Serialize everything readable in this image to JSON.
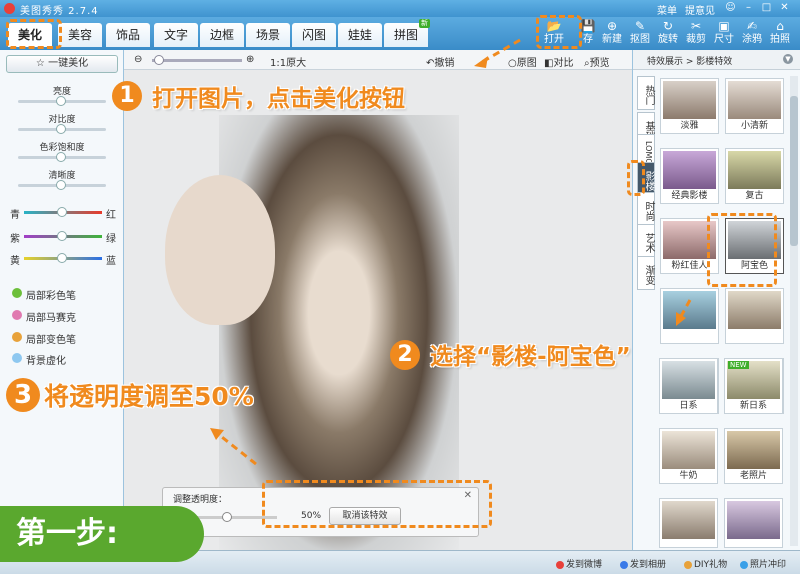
{
  "window": {
    "app_title": "美图秀秀 2.7.4",
    "menu": "菜单",
    "feedback": "提意见",
    "controls": [
      "☺",
      "–",
      "□",
      "✕"
    ]
  },
  "tabs": [
    {
      "label": "美化",
      "active": true
    },
    {
      "label": "美容"
    },
    {
      "label": "饰品"
    },
    {
      "label": "文字"
    },
    {
      "label": "边框"
    },
    {
      "label": "场景"
    },
    {
      "label": "闪图"
    },
    {
      "label": "娃娃"
    },
    {
      "label": "拼图",
      "badge": "新"
    }
  ],
  "tools": [
    {
      "label": "打开",
      "icon": "open-folder-icon",
      "glyph": "📂"
    },
    {
      "label": "存",
      "icon": "save-icon",
      "glyph": "💾"
    },
    {
      "label": "新建",
      "icon": "new-icon",
      "glyph": "⊕"
    },
    {
      "label": "抠图",
      "icon": "cutout-icon",
      "glyph": "✎"
    },
    {
      "label": "旋转",
      "icon": "rotate-icon",
      "glyph": "↻"
    },
    {
      "label": "裁剪",
      "icon": "crop-icon",
      "glyph": "✂"
    },
    {
      "label": "尺寸",
      "icon": "resize-icon",
      "glyph": "▣"
    },
    {
      "label": "涂鸦",
      "icon": "doodle-icon",
      "glyph": "✍"
    },
    {
      "label": "拍照",
      "icon": "camera-icon",
      "glyph": "⌂"
    }
  ],
  "left_panel": {
    "one_key": "一键美化",
    "sliders": [
      "亮度",
      "对比度",
      "色彩饱和度",
      "清晰度"
    ],
    "color_sliders": [
      {
        "left": "青",
        "right": "红"
      },
      {
        "left": "紫",
        "right": "绿"
      },
      {
        "left": "黄",
        "right": "蓝"
      }
    ],
    "local_tools": [
      "局部彩色笔",
      "局部马赛克",
      "局部变色笔",
      "背景虚化"
    ]
  },
  "canvas": {
    "zoom_label": "1:1原大",
    "undo": "撤销",
    "original": "原图",
    "compare": "对比",
    "preview": "预览"
  },
  "opacity_panel": {
    "title": "调整透明度：",
    "value": "50%",
    "cancel": "取消该特效",
    "close": "✕"
  },
  "right_panel": {
    "breadcrumb": "特效展示 > 影楼特效",
    "vertical_tabs": [
      "热门",
      "基础",
      "LOMO",
      "影楼",
      "时尚",
      "艺术",
      "渐变"
    ],
    "effects": [
      {
        "label": "淡雅"
      },
      {
        "label": "小清新"
      },
      {
        "label": "经典影楼"
      },
      {
        "label": "复古"
      },
      {
        "label": "粉红佳人"
      },
      {
        "label": "阿宝色",
        "selected": true
      },
      {
        "label": ""
      },
      {
        "label": ""
      },
      {
        "label": ""
      },
      {
        "label": ""
      },
      {
        "label": "日系"
      },
      {
        "label": "新日系",
        "badge": "NEW"
      },
      {
        "label": "牛奶"
      },
      {
        "label": "老照片"
      },
      {
        "label": ""
      },
      {
        "label": ""
      }
    ]
  },
  "statusbar": {
    "weibo": "发到微博",
    "album": "发到相册",
    "diy": "DIY礼物",
    "print": "照片冲印"
  },
  "annotations": {
    "step1_num": "1",
    "step1_text": "打开图片，点击美化按钮",
    "step2_num": "2",
    "step2_text": "选择“影楼-阿宝色”",
    "step3_num": "3",
    "step3_text": "将透明度调至50%",
    "step_badge": "第一步:",
    "accent_color": "#f08a1e",
    "badge_color": "#5aa82e"
  }
}
